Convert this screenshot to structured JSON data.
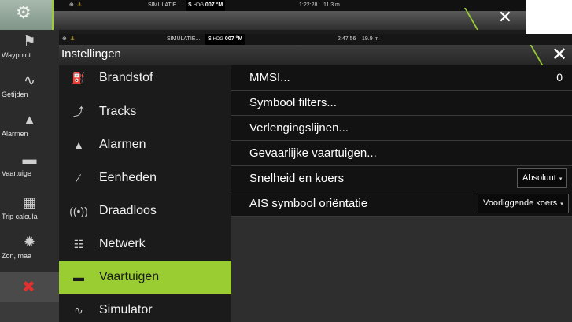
{
  "back_window": {
    "status": {
      "icons": [
        "⊕",
        "⚓"
      ],
      "mode": "SIMULATIE...",
      "hdg_prefix": "S",
      "hdg_label": "HDG",
      "hdg_value": "007 °M",
      "time": "1:22:28",
      "dist": "11.3 m"
    },
    "sidebar": [
      {
        "icon": "⚑",
        "label": "Waypoint"
      },
      {
        "icon": "∿",
        "label": "Getijden"
      },
      {
        "icon": "▲",
        "label": "Alarmen"
      },
      {
        "icon": "▬",
        "label": "Vaartuige"
      },
      {
        "icon": "▦",
        "label": "Trip calcula"
      },
      {
        "icon": "✹",
        "label": "Zon, maa"
      }
    ],
    "close_glyph": "✕",
    "cancel_glyph": "✖",
    "gear_glyph": "⚙"
  },
  "front_window": {
    "status": {
      "icons": [
        "⊕",
        "⚓"
      ],
      "mode": "SIMULATIE...",
      "hdg_prefix": "S",
      "hdg_label": "HDG",
      "hdg_value": "007 °M",
      "time": "2:47:56",
      "dist": "19.9 m"
    },
    "title": "Instellingen",
    "close_glyph": "✕",
    "menu": [
      {
        "icon": "⛽",
        "label": "Brandstof"
      },
      {
        "icon": "⤴",
        "label": "Tracks"
      },
      {
        "icon": "▲",
        "label": "Alarmen"
      },
      {
        "icon": "∕",
        "label": "Eenheden"
      },
      {
        "icon": "((•))",
        "label": "Draadloos"
      },
      {
        "icon": "☷",
        "label": "Netwerk"
      },
      {
        "icon": "▬",
        "label": "Vaartuigen"
      },
      {
        "icon": "∿",
        "label": "Simulator"
      }
    ],
    "selected_menu": "Vaartuigen",
    "options": [
      {
        "label": "MMSI...",
        "value": "0"
      },
      {
        "label": "Symbool filters..."
      },
      {
        "label": "Verlengingslijnen..."
      },
      {
        "label": "Gevaarlijke vaartuigen..."
      },
      {
        "label": "Snelheid en koers",
        "dropdown": "Absoluut"
      },
      {
        "label": "AIS symbool oriëntatie",
        "dropdown": "Voorliggende koers"
      }
    ],
    "chevron_glyph": "▾"
  },
  "colors": {
    "accent": "#9acd32",
    "panel": "#1b1b1b",
    "pane": "#2e2e2e",
    "row": "#121212",
    "cancel_red": "#e03030"
  }
}
